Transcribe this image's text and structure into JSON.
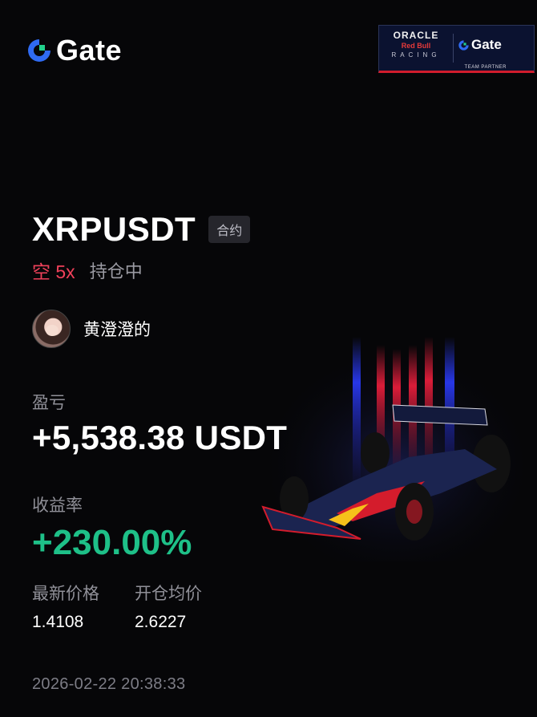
{
  "brand": {
    "name": "Gate",
    "logo_icon": "gate-logo-icon"
  },
  "partner_badge": {
    "oracle": "ORACLE",
    "redbull": "Red Bull",
    "racing": "RACING",
    "gate": "Gate",
    "team_partner": "TEAM PARTNER"
  },
  "position": {
    "symbol": "XRPUSDT",
    "contract_tag": "合约",
    "side": "空 5x",
    "status": "持仓中"
  },
  "user": {
    "name": "黄澄澄的",
    "avatar_icon": "user-avatar"
  },
  "pnl": {
    "label": "盈亏",
    "value": "+5,538.38 USDT"
  },
  "roi": {
    "label": "收益率",
    "value": "+230.00%"
  },
  "prices": {
    "last_label": "最新价格",
    "last_value": "1.4108",
    "entry_label": "开仓均价",
    "entry_value": "2.6227"
  },
  "timestamp": "2026-02-22 20:38:33",
  "colors": {
    "short": "#f0415a",
    "profit": "#1ec088",
    "background": "#060608"
  }
}
